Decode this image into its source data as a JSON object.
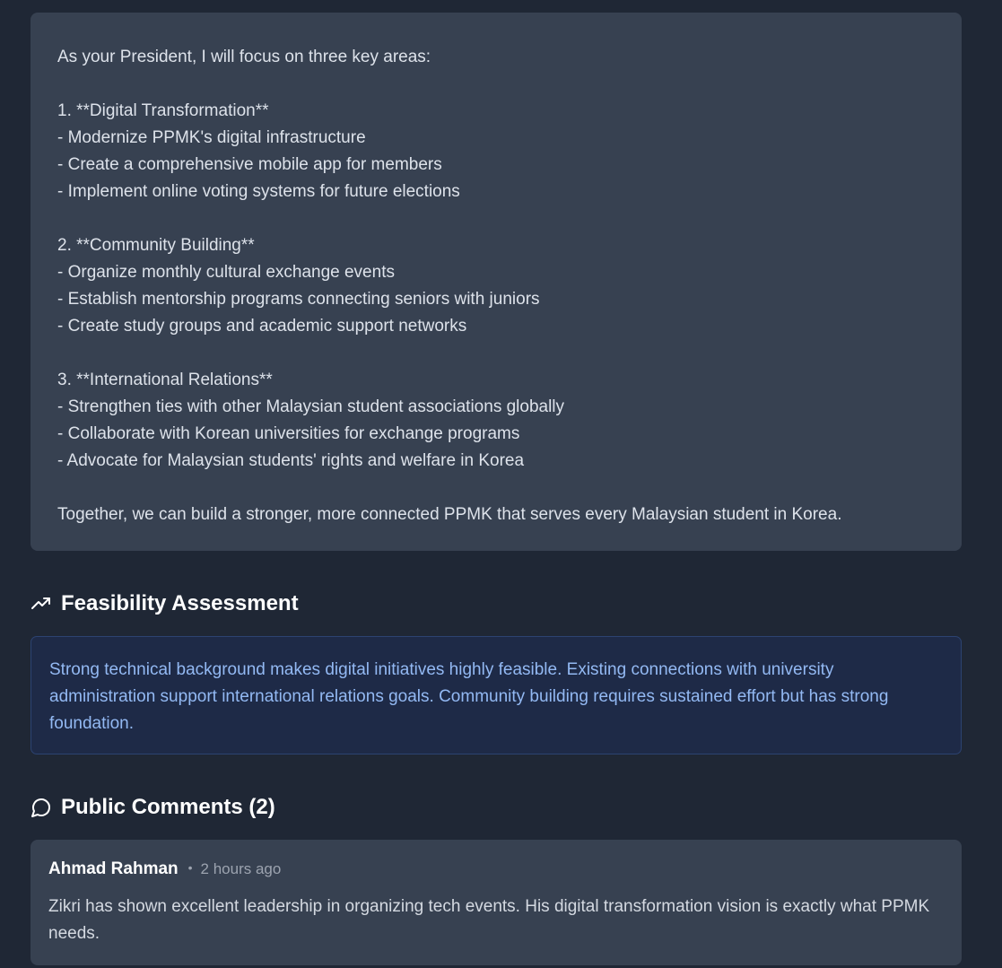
{
  "manifesto": {
    "text": "As your President, I will focus on three key areas:\n\n1. **Digital Transformation**\n- Modernize PPMK's digital infrastructure\n- Create a comprehensive mobile app for members\n- Implement online voting systems for future elections\n\n2. **Community Building**\n- Organize monthly cultural exchange events\n- Establish mentorship programs connecting seniors with juniors\n- Create study groups and academic support networks\n\n3. **International Relations**\n- Strengthen ties with other Malaysian student associations globally\n- Collaborate with Korean universities for exchange programs\n- Advocate for Malaysian students' rights and welfare in Korea\n\nTogether, we can build a stronger, more connected PPMK that serves every Malaysian student in Korea."
  },
  "feasibility": {
    "icon": "trending-up-icon",
    "title": "Feasibility Assessment",
    "text": "Strong technical background makes digital initiatives highly feasible. Existing connections with university administration support international relations goals. Community building requires sustained effort but has strong foundation."
  },
  "comments": {
    "icon": "message-circle-icon",
    "title": "Public Comments (2)",
    "items": [
      {
        "author": "Ahmad Rahman",
        "separator": "•",
        "time": "2 hours ago",
        "text": "Zikri has shown excellent leadership in organizing tech events. His digital transformation vision is exactly what PPMK needs."
      }
    ]
  },
  "colors": {
    "background": "#1f2735",
    "card": "#374151",
    "feasibility_bg": "#1e2a47",
    "feasibility_border": "#2c4371",
    "feasibility_text": "#93b9f3"
  }
}
